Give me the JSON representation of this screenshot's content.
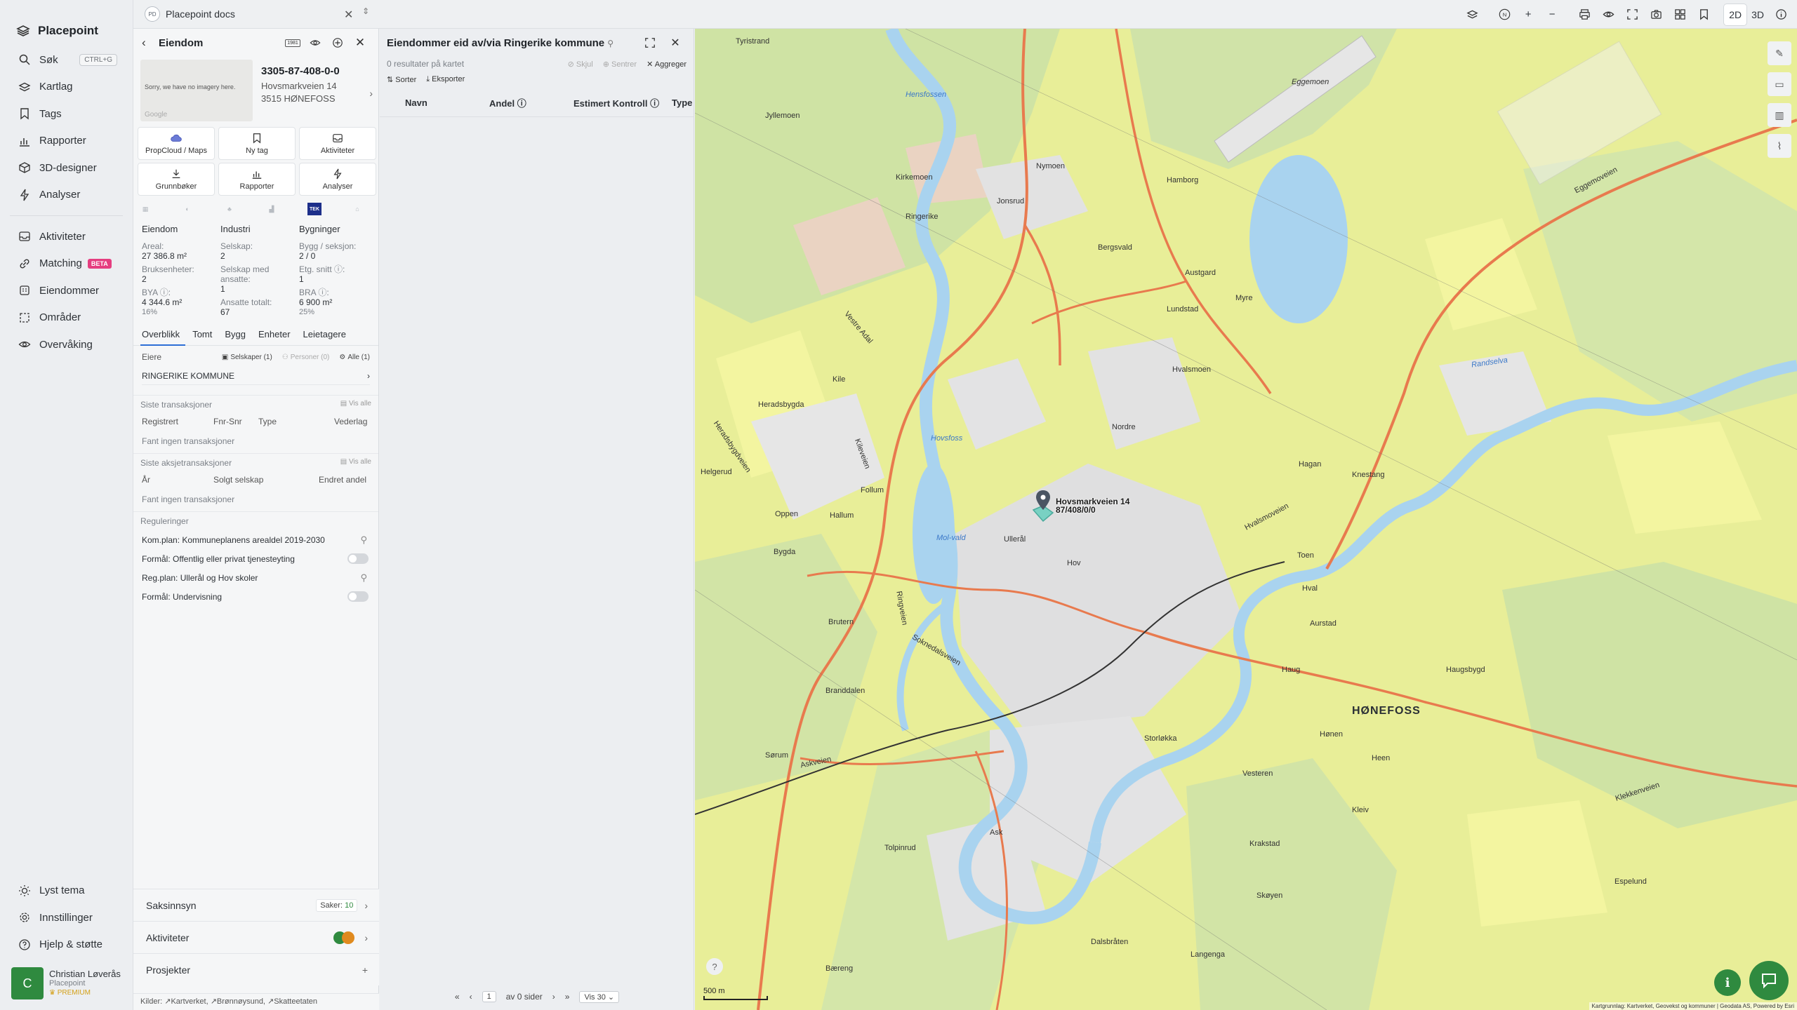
{
  "app": {
    "name": "Placepoint"
  },
  "nav": {
    "items": [
      {
        "label": "Søk",
        "shortcut": "CTRL+G"
      },
      {
        "label": "Kartlag"
      },
      {
        "label": "Tags"
      },
      {
        "label": "Rapporter"
      },
      {
        "label": "3D-designer"
      },
      {
        "label": "Analyser"
      }
    ],
    "items2": [
      {
        "label": "Aktiviteter"
      },
      {
        "label": "Matching",
        "badge": "BETA"
      },
      {
        "label": "Eiendommer"
      },
      {
        "label": "Områder"
      },
      {
        "label": "Overvåking"
      }
    ],
    "bottom": [
      {
        "label": "Lyst tema"
      },
      {
        "label": "Innstillinger"
      },
      {
        "label": "Hjelp & støtte"
      }
    ],
    "user": {
      "initial": "C",
      "name": "Christian Løverås",
      "org": "Placepoint",
      "plan": "PREMIUM"
    }
  },
  "topbar": {
    "doc_badge": "PD",
    "doc_title": "Placepoint docs",
    "view_2d": "2D",
    "view_3d": "3D",
    "north": "N"
  },
  "property": {
    "header": "Eiendom",
    "year_badge": "1981",
    "thumb_text": "Sorry, we have no imagery here.",
    "thumb_credit": "Google",
    "id": "3305-87-408-0-0",
    "address1": "Hovsmarkveien 14",
    "address2": "3515 HØNEFOSS",
    "actions": [
      "PropCloud / Maps",
      "Ny tag",
      "Aktiviteter",
      "Grunnbøker",
      "Rapporter",
      "Analyser"
    ],
    "tek_badge": "TEK",
    "stats": {
      "col1": {
        "head": "Eiendom",
        "areal_l": "Areal:",
        "areal_v": "27 386.8 m²",
        "bruks_l": "Bruksenheter:",
        "bruks_v": "2",
        "bya_l": "BYA ⓘ:",
        "bya_v": "4 344.6 m²",
        "bya_p": "16%"
      },
      "col2": {
        "head": "Industri",
        "sel_l": "Selskap:",
        "sel_v": "2",
        "selans_l": "Selskap med ansatte:",
        "selans_v": "1",
        "ans_l": "Ansatte totalt:",
        "ans_v": "67"
      },
      "col3": {
        "head": "Bygninger",
        "bygg_l": "Bygg / seksjon:",
        "bygg_v": "2 / 0",
        "etg_l": "Etg. snitt ⓘ:",
        "etg_v": "1",
        "bra_l": "BRA ⓘ:",
        "bra_v": "6 900 m²",
        "bra_p": "25%"
      }
    },
    "tabs": [
      "Overblikk",
      "Tomt",
      "Bygg",
      "Enheter",
      "Leietagere"
    ],
    "owners": {
      "label": "Eiere",
      "chip_selskaper": "Selskaper (1)",
      "chip_personer": "Personer (0)",
      "chip_alle": "Alle (1)",
      "owner": "RINGERIKE KOMMUNE"
    },
    "transactions": {
      "title": "Siste transaksjoner",
      "vis_alle": "Vis alle",
      "cols": [
        "Registrert",
        "Fnr-Snr",
        "Type",
        "Vederlag"
      ],
      "empty": "Fant ingen transaksjoner"
    },
    "share_transactions": {
      "title": "Siste aksjetransaksjoner",
      "vis_alle": "Vis alle",
      "cols": [
        "År",
        "Solgt selskap",
        "Endret andel"
      ],
      "empty": "Fant ingen transaksjoner"
    },
    "regulations": {
      "title": "Reguleringer",
      "rows": [
        "Kom.plan: Kommuneplanens arealdel 2019-2030",
        "Formål: Offentlig eller privat tjenesteyting",
        "Reg.plan: Ullerål og Hov skoler",
        "Formål: Undervisning"
      ]
    },
    "accordions": {
      "saksinnsyn": "Saksinnsyn",
      "saker_label": "Saker:",
      "saker_count": "10",
      "aktiviteter": "Aktiviteter",
      "prosjekter": "Prosjekter"
    },
    "sources": "Kilder: ↗Kartverket, ↗Brønnøysund, ↗Skatteetaten"
  },
  "results": {
    "title": "Eiendommer eid av/via Ringerike kommune",
    "count": "0 resultater på kartet",
    "skjul": "Skjul",
    "sentrer": "Sentrer",
    "aggreger": "Aggreger",
    "sorter": "Sorter",
    "eksporter": "Eksporter",
    "columns": [
      "Navn",
      "Andel ⓘ",
      "Estimert Kontroll ⓘ",
      "Type"
    ],
    "pager": {
      "page": "1",
      "of": "av 0 sider",
      "per_page": "Vis 30"
    }
  },
  "map": {
    "labels": [
      "HØNEFOSS",
      "Vestre Adal",
      "Soknedalsveien",
      "Hvalsmoveien",
      "Eggemoveien",
      "Klekkenveien",
      "Askveien",
      "Heradsbygdveien",
      "Kileveien",
      "Ringveien",
      "Mol-vald",
      "Hovsfoss",
      "Hensfossen",
      "Ullerål",
      "Hov",
      "Nordre",
      "Hvalsmoen",
      "Eggemoen",
      "Hamborg",
      "Austgard",
      "Lundstad",
      "Myre",
      "Hagan",
      "Knestang",
      "Toen",
      "Hval",
      "Aurstad",
      "Haug",
      "Hønen",
      "Heen",
      "Kleiv",
      "Brutern",
      "Branddalen",
      "Sørum",
      "Tolpinrud",
      "Ask",
      "Bæreng",
      "Dalsbråten",
      "Skøyen",
      "Krakstad",
      "Langenga",
      "Storløkka",
      "Vesteren",
      "Follum",
      "Hallum",
      "Oppen",
      "Bygda",
      "Kile",
      "Jyllemoen",
      "Tyristrand",
      "Nymoen",
      "Jonsrud",
      "Randselva",
      "Heradsbygda",
      "Haugsbygd",
      "Ringerike",
      "Helgerud",
      "Kirkemoen",
      "Espelund",
      "Bergsvald"
    ],
    "marker_label_1": "Hovsmarkveien 14",
    "marker_label_2": "87/408/0/0",
    "scale": "500 m",
    "attribution": "Kartgrunnlag: Kartverket, Geovekst og kommuner | Geodata AS, Powered by Esri"
  }
}
